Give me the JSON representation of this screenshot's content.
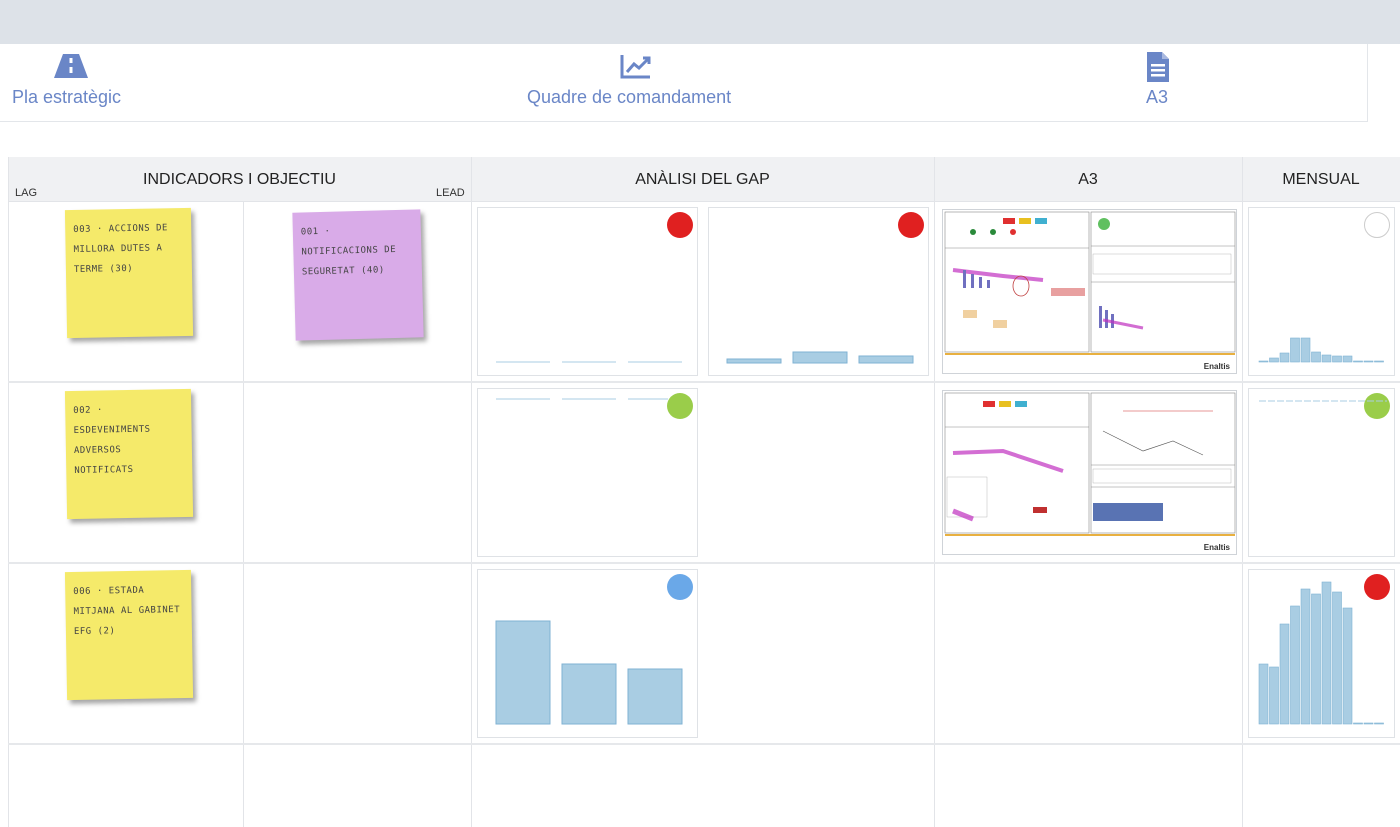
{
  "nav": {
    "items": [
      {
        "label": "Pla estratègic",
        "icon": "road-icon"
      },
      {
        "label": "Quadre de comandament",
        "icon": "chart-line-icon"
      },
      {
        "label": "A3",
        "icon": "document-icon"
      }
    ]
  },
  "grid": {
    "headers": {
      "indicators": "INDICADORS I OBJECTIU",
      "lag": "LAG",
      "lead": "LEAD",
      "gap": "ANÀLISI DEL GAP",
      "a3": "A3",
      "monthly": "MENSUAL"
    },
    "rows": [
      {
        "lag_note": "003 · ACCIONS DE MILLORA DUTES A TERME (30)",
        "lead_note": "001 · NOTIFICACIONS DE SEGURETAT (40)",
        "gap_lag_status": "red",
        "gap_lead_status": "red",
        "monthly_status": "white"
      },
      {
        "lag_note": "002 · ESDEVENIMENTS ADVERSOS NOTIFICATS",
        "gap_lag_status": "green",
        "monthly_status": "green"
      },
      {
        "lag_note": "006 · ESTADA MITJANA AL GABINET EFG (2)",
        "gap_lag_status": "blue",
        "monthly_status": "red"
      }
    ],
    "a3_brand": "Enaltis"
  },
  "colors": {
    "red": "#e02020",
    "green": "#9acd4a",
    "blue": "#6aa8e8",
    "accent": "#6a86c7",
    "bar": "#a9cde3"
  }
}
